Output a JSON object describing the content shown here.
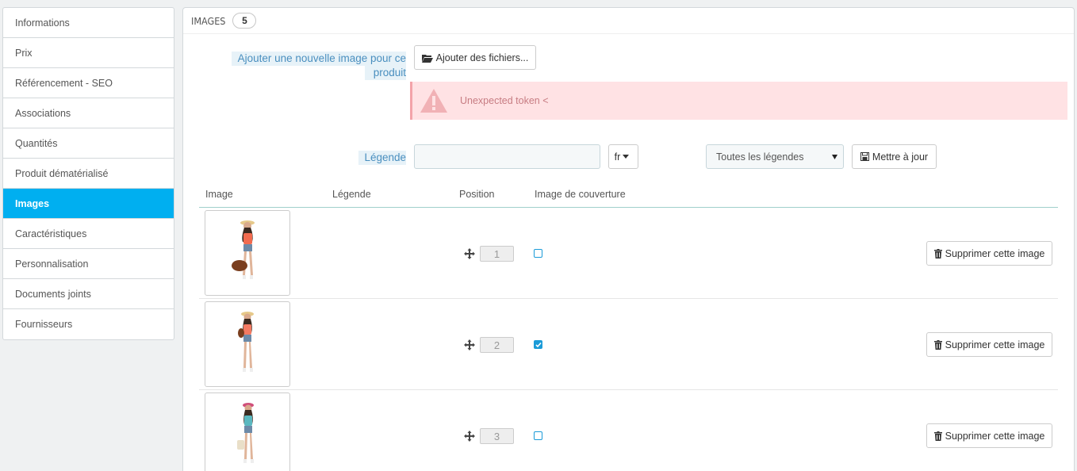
{
  "sidebar": {
    "items": [
      {
        "label": "Informations"
      },
      {
        "label": "Prix"
      },
      {
        "label": "Référencement - SEO"
      },
      {
        "label": "Associations"
      },
      {
        "label": "Quantités"
      },
      {
        "label": "Produit dématérialisé"
      },
      {
        "label": "Images",
        "active": true
      },
      {
        "label": "Caractéristiques"
      },
      {
        "label": "Personnalisation"
      },
      {
        "label": "Documents joints"
      },
      {
        "label": "Fournisseurs"
      }
    ]
  },
  "panel": {
    "title": "IMAGES",
    "count": "5"
  },
  "upload": {
    "label": "Ajouter une nouvelle image pour ce produit",
    "label_line1": "Ajouter une nouvelle image pour ce",
    "label_line2": "produit",
    "button": "Ajouter des fichiers..."
  },
  "alert": {
    "message": "Unexpected token <"
  },
  "legend": {
    "label": "Légende",
    "value": "",
    "lang": "fr",
    "filter_selected": "Toutes les légendes",
    "update_button": "Mettre à jour"
  },
  "table": {
    "headers": [
      "Image",
      "Légende",
      "Position",
      "Image de couverture"
    ],
    "rows": [
      {
        "position": "1",
        "cover": false,
        "delete_label": "Supprimer cette image"
      },
      {
        "position": "2",
        "cover": true,
        "delete_label": "Supprimer cette image"
      },
      {
        "position": "3",
        "cover": false,
        "delete_label": "Supprimer cette image"
      }
    ]
  },
  "colors": {
    "accent": "#00aff0",
    "alert_bg": "#ffe2e4",
    "checkbox": "#1b9bd8"
  }
}
